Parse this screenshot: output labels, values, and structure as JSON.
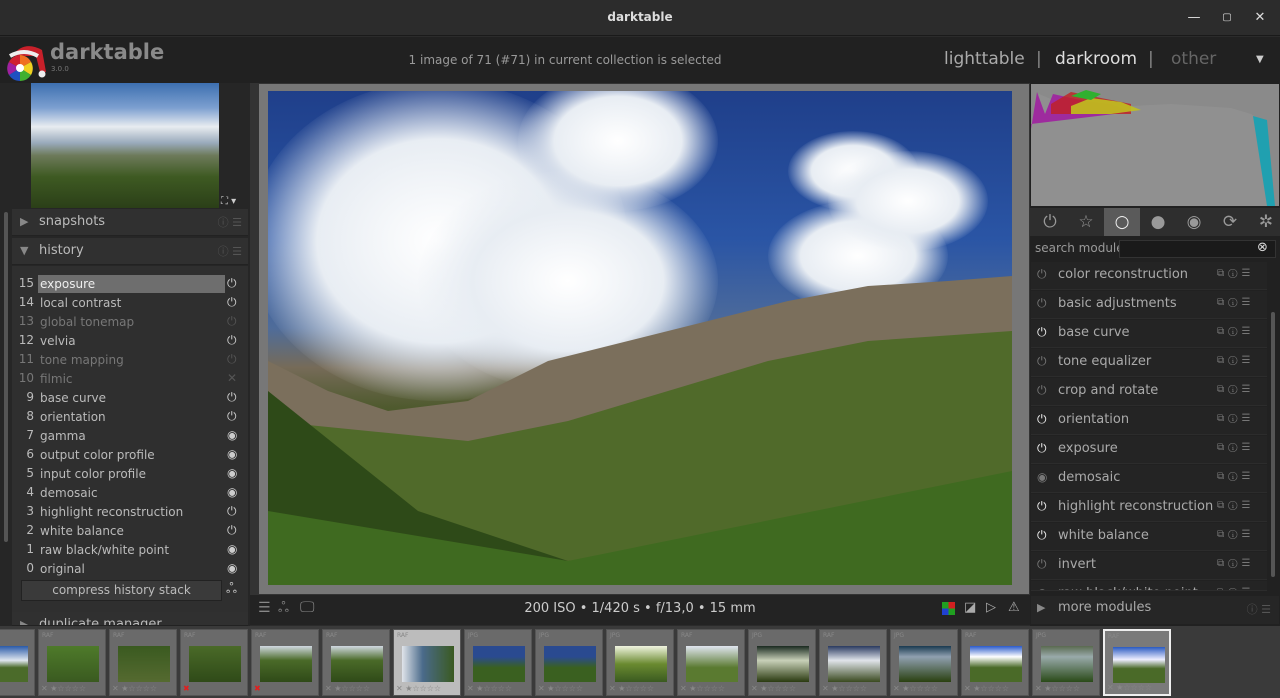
{
  "window": {
    "title": "darktable",
    "minimize": "—",
    "maximize": "▢",
    "close": "✕"
  },
  "header": {
    "brand": "darktable",
    "version": "3.0.0",
    "selection_info": "1 image of 71 (#71) in current collection is selected",
    "views": [
      {
        "label": "lighttable",
        "state": "inactive"
      },
      {
        "label": "darkroom",
        "state": "active"
      },
      {
        "label": "other",
        "state": "dim"
      }
    ],
    "separator": "|",
    "dropdown": "▼"
  },
  "left": {
    "snapshots": {
      "label": "snapshots",
      "arrow": "▶"
    },
    "history": {
      "label": "history",
      "arrow": "▼",
      "items": [
        {
          "n": "15",
          "label": "exposure",
          "state": "on",
          "selected": true
        },
        {
          "n": "14",
          "label": "local contrast",
          "state": "on"
        },
        {
          "n": "13",
          "label": "global tonemap",
          "state": "off"
        },
        {
          "n": "12",
          "label": "velvia",
          "state": "on"
        },
        {
          "n": "11",
          "label": "tone mapping",
          "state": "off"
        },
        {
          "n": "10",
          "label": "filmic",
          "state": "deprecated"
        },
        {
          "n": "9",
          "label": "base curve",
          "state": "on"
        },
        {
          "n": "8",
          "label": "orientation",
          "state": "on"
        },
        {
          "n": "7",
          "label": "gamma",
          "state": "always"
        },
        {
          "n": "6",
          "label": "output color profile",
          "state": "always"
        },
        {
          "n": "5",
          "label": "input color profile",
          "state": "always"
        },
        {
          "n": "4",
          "label": "demosaic",
          "state": "always"
        },
        {
          "n": "3",
          "label": "highlight reconstruction",
          "state": "on"
        },
        {
          "n": "2",
          "label": "white balance",
          "state": "on"
        },
        {
          "n": "1",
          "label": "raw black/white point",
          "state": "always"
        },
        {
          "n": "0",
          "label": "original",
          "state": "always"
        }
      ],
      "compress": "compress history stack"
    },
    "duplicate": {
      "label": "duplicate manager",
      "arrow": "▶"
    }
  },
  "bottombar": {
    "exif": "200 ISO • 1/420 s • f/13,0 • 15 mm"
  },
  "right": {
    "groups": [
      {
        "icon": "power-icon",
        "g": "⏻"
      },
      {
        "icon": "star-icon",
        "g": "☆"
      },
      {
        "icon": "circle-icon",
        "g": "○",
        "active": true
      },
      {
        "icon": "tone-sphere-icon",
        "g": "●"
      },
      {
        "icon": "color-wheel-icon",
        "g": "◉"
      },
      {
        "icon": "correct-icon",
        "g": "⟳"
      },
      {
        "icon": "effect-icon",
        "g": "✲"
      }
    ],
    "search": {
      "label": "search module",
      "value": "",
      "placeholder": ""
    },
    "modules": [
      {
        "label": "color reconstruction",
        "on": false
      },
      {
        "label": "basic adjustments",
        "on": false
      },
      {
        "label": "base curve",
        "on": true
      },
      {
        "label": "tone equalizer",
        "on": false
      },
      {
        "label": "crop and rotate",
        "on": false
      },
      {
        "label": "orientation",
        "on": true
      },
      {
        "label": "exposure",
        "on": true
      },
      {
        "label": "demosaic",
        "on": "always"
      },
      {
        "label": "highlight reconstruction",
        "on": true
      },
      {
        "label": "white balance",
        "on": true
      },
      {
        "label": "invert",
        "on": false
      },
      {
        "label": "raw black/white point",
        "on": "always"
      }
    ],
    "more": "more modules"
  },
  "filmstrip": [
    {
      "ext": "",
      "stars": "☆☆☆"
    },
    {
      "ext": "RAF",
      "stars": "✕ ★☆☆☆☆"
    },
    {
      "ext": "RAF",
      "stars": "✕ ★☆☆☆☆"
    },
    {
      "ext": "RAF",
      "stars": "✖",
      "rejected": true
    },
    {
      "ext": "RAF",
      "stars": "✖",
      "rejected": true
    },
    {
      "ext": "RAF",
      "stars": "✕ ★☆☆☆☆"
    },
    {
      "ext": "RAF",
      "stars": "✕ ★☆☆☆☆",
      "current": true
    },
    {
      "ext": "JPG",
      "stars": "✕ ★☆☆☆☆"
    },
    {
      "ext": "JPG",
      "stars": "✕ ★☆☆☆☆"
    },
    {
      "ext": "JPG",
      "stars": "✕ ★☆☆☆☆"
    },
    {
      "ext": "RAF",
      "stars": "✕ ★☆☆☆☆"
    },
    {
      "ext": "JPG",
      "stars": "✕ ★☆☆☆☆"
    },
    {
      "ext": "RAF",
      "stars": "✕ ★☆☆☆☆"
    },
    {
      "ext": "JPG",
      "stars": "✕ ★☆☆☆☆"
    },
    {
      "ext": "RAF",
      "stars": "✕ ★☆☆☆☆"
    },
    {
      "ext": "JPG",
      "stars": "✕ ★☆☆☆☆"
    },
    {
      "ext": "RAF",
      "stars": "✕ ★☆☆☆☆",
      "active": true
    }
  ],
  "colors": {
    "accent_selected": "#6e6e6e",
    "rejected": "#e02020"
  }
}
